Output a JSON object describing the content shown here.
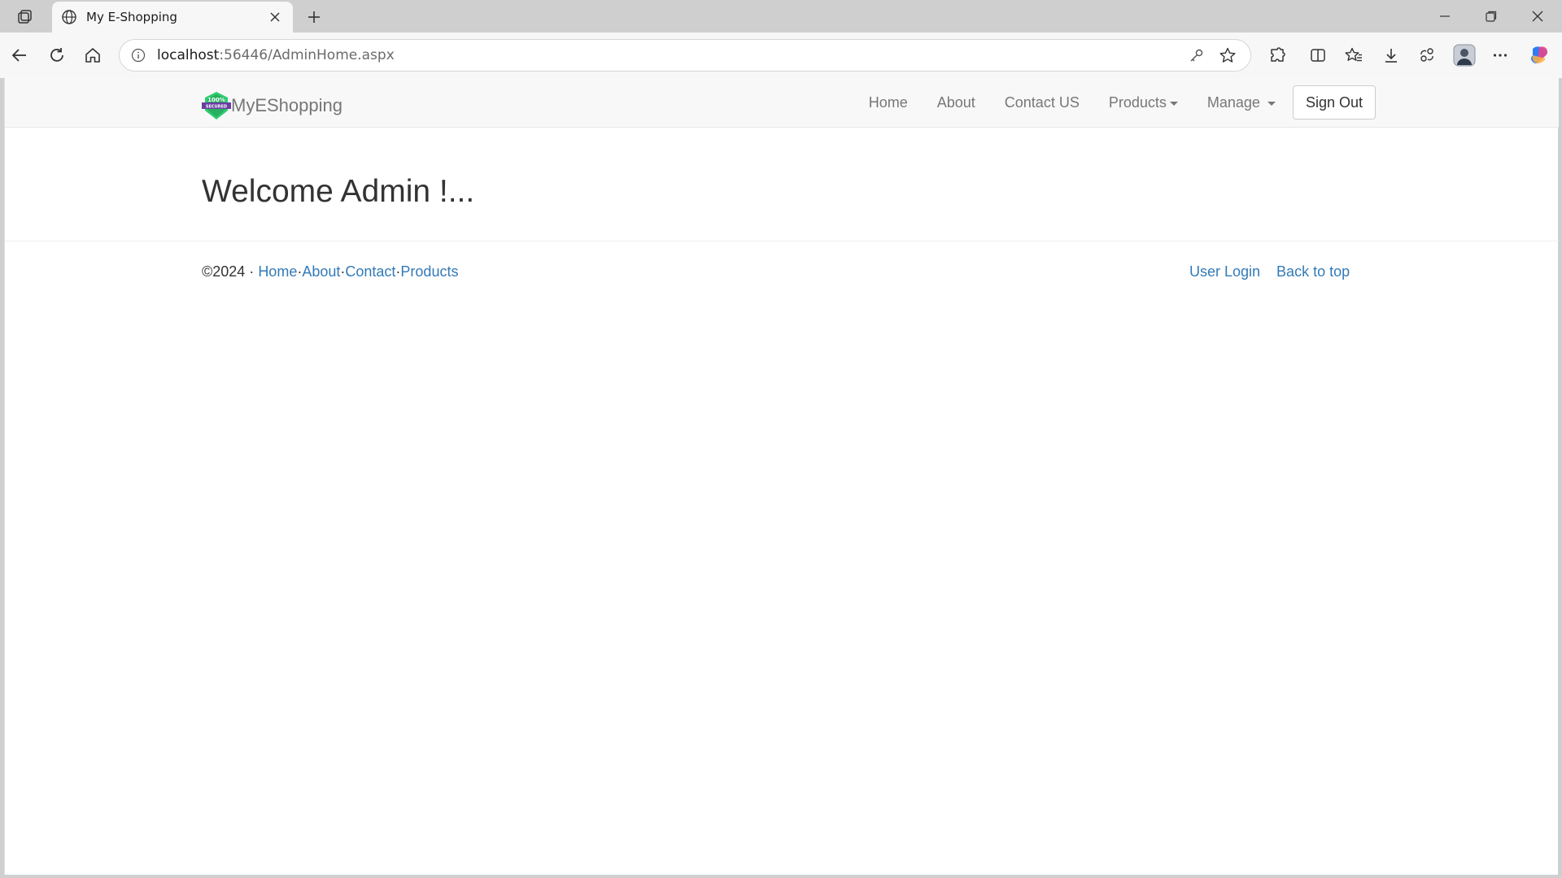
{
  "browser": {
    "tab_title": "My E-Shopping",
    "url_host": "localhost",
    "url_rest": ":56446/AdminHome.aspx"
  },
  "site": {
    "brand": "MyEShopping",
    "logo_text": "100% SECURED",
    "nav": {
      "home": "Home",
      "about": "About",
      "contact": "Contact US",
      "products": "Products",
      "manage": "Manage",
      "sign_out": "Sign Out"
    },
    "welcome": "Welcome Admin !...",
    "footer": {
      "copyright": "©2024 · ",
      "home": "Home",
      "about": "About",
      "contact": "Contact",
      "products": "Products",
      "sep": "·",
      "user_login": "User Login",
      "back_to_top": "Back to top"
    }
  },
  "colors": {
    "link": "#337ab7",
    "navbar_bg": "#f8f8f8",
    "logo_green": "#2ecc71",
    "logo_purple": "#6a3fa0"
  },
  "icons": [
    "workspaces-icon",
    "globe-icon",
    "close-icon",
    "plus-icon",
    "minimize-icon",
    "restore-icon",
    "window-close-icon",
    "back-icon",
    "refresh-icon",
    "home-icon",
    "info-icon",
    "key-icon",
    "star-icon",
    "extensions-icon",
    "split-screen-icon",
    "favorites-icon",
    "download-icon",
    "share-icon",
    "profile-icon",
    "more-icon",
    "copilot-icon"
  ]
}
